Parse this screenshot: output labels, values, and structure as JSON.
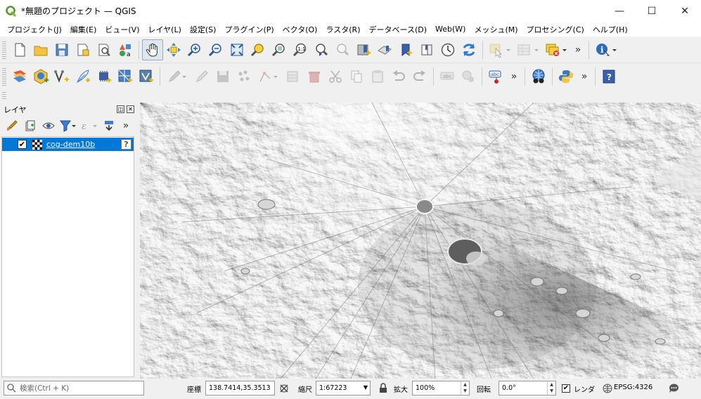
{
  "window": {
    "title": "*無題のプロジェクト — QGIS",
    "minimize": "—",
    "maximize": "☐",
    "close": "✕"
  },
  "menu": [
    "プロジェクト(J)",
    "編集(E)",
    "ビュー(V)",
    "レイヤ(L)",
    "設定(S)",
    "プラグイン(P)",
    "ベクタ(O)",
    "ラスタ(R)",
    "データベース(D)",
    "Web(W)",
    "メッシュ(M)",
    "プロセシング(C)",
    "ヘルプ(H)"
  ],
  "toolbar": {
    "overflow": "»"
  },
  "layers_panel": {
    "title": "レイヤ",
    "float": "◫",
    "close": "✕",
    "overflow": "»",
    "layers": [
      {
        "name": "cog-dem10b",
        "checked": "✔",
        "status": "?"
      }
    ]
  },
  "statusbar": {
    "search_placeholder": "検索(Ctrl + K)",
    "coord_label": "座標",
    "coord_value": "138.7414,35.3513",
    "scale_label": "縮尺",
    "scale_value": "1:67223",
    "magnifier_label": "拡大",
    "magnifier_value": "100%",
    "rotation_label": "回転",
    "rotation_value": "0.0°",
    "render_label": "レンダ",
    "render_checked": "✔",
    "crs": "EPSG:4326"
  },
  "colors": {
    "selection": "#0078d7",
    "map_background": "#c8c8c8"
  }
}
